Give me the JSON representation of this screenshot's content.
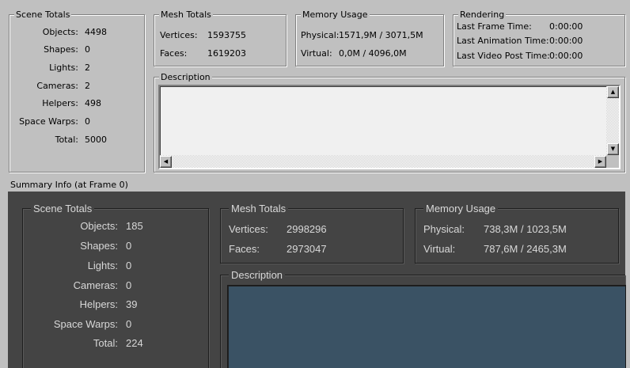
{
  "top": {
    "scene_totals": {
      "title": "Scene Totals",
      "rows": [
        {
          "label": "Objects:",
          "value": "4498"
        },
        {
          "label": "Shapes:",
          "value": "0"
        },
        {
          "label": "Lights:",
          "value": "2"
        },
        {
          "label": "Cameras:",
          "value": "2"
        },
        {
          "label": "Helpers:",
          "value": "498"
        },
        {
          "label": "Space Warps:",
          "value": "0"
        },
        {
          "label": "Total:",
          "value": "5000"
        }
      ]
    },
    "mesh_totals": {
      "title": "Mesh Totals",
      "vertices_label": "Vertices:",
      "vertices_value": "1593755",
      "faces_label": "Faces:",
      "faces_value": "1619203"
    },
    "memory_usage": {
      "title": "Memory Usage",
      "physical_label": "Physical:",
      "physical_value": "1571,9M / 3071,5M",
      "virtual_label": "Virtual:",
      "virtual_value": "0,0M / 4096,0M"
    },
    "rendering": {
      "title": "Rendering",
      "rows": [
        {
          "label": "Last Frame Time:",
          "value": "0:00:00"
        },
        {
          "label": "Last Animation Time:",
          "value": "0:00:00"
        },
        {
          "label": "Last Video Post Time:",
          "value": "0:00:00"
        }
      ]
    },
    "description": {
      "title": "Description",
      "text": ""
    }
  },
  "summary_label": "Summary Info (at Frame 0)",
  "bottom": {
    "scene_totals": {
      "title": "Scene Totals",
      "rows": [
        {
          "label": "Objects:",
          "value": "185"
        },
        {
          "label": "Shapes:",
          "value": "0"
        },
        {
          "label": "Lights:",
          "value": "0"
        },
        {
          "label": "Cameras:",
          "value": "0"
        },
        {
          "label": "Helpers:",
          "value": "39"
        },
        {
          "label": "Space Warps:",
          "value": "0"
        },
        {
          "label": "Total:",
          "value": "224"
        }
      ]
    },
    "mesh_totals": {
      "title": "Mesh Totals",
      "vertices_label": "Vertices:",
      "vertices_value": "2998296",
      "faces_label": "Faces:",
      "faces_value": "2973047"
    },
    "memory_usage": {
      "title": "Memory Usage",
      "physical_label": "Physical:",
      "physical_value": "738,3M / 1023,5M",
      "virtual_label": "Virtual:",
      "virtual_value": "787,6M / 2465,3M"
    },
    "description": {
      "title": "Description",
      "text": ""
    }
  },
  "icons": {
    "scroll_up": "triangle-up-icon",
    "scroll_down": "triangle-down-icon",
    "scroll_left": "triangle-left-icon",
    "scroll_right": "triangle-right-icon"
  },
  "colors": {
    "light_bg": "#c0c0c0",
    "dark_bg": "#444444",
    "dark_text": "#d8d8d8",
    "dark_description_fill": "#3a5264"
  }
}
